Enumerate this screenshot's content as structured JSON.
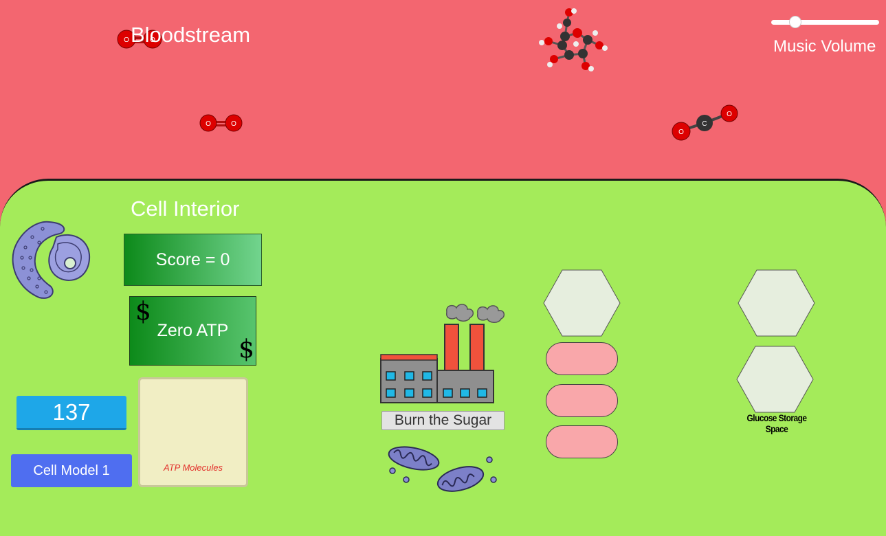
{
  "bloodstream": {
    "title": "Bloodstream"
  },
  "settings": {
    "music_volume_label": "Music Volume",
    "music_volume_level": 0.17
  },
  "cell": {
    "title": "Cell Interior",
    "score_label": "Score = 0",
    "atp_label": "Zero ATP",
    "atp_symbol": "$",
    "counter_value": "137",
    "cell_model_button": "Cell Model 1",
    "atp_panel_label": "ATP Molecules",
    "burn_button": "Burn the Sugar",
    "glucose_storage_label": "Glucose Storage Space"
  },
  "molecules": {
    "oxygen_symbol": "O",
    "carbon_symbol": "C"
  },
  "colors": {
    "bloodstream": "#f36670",
    "cell_interior": "#a4eb5a",
    "score_green": "#0d8a1a",
    "counter_blue": "#1ea7e8",
    "model_button_blue": "#4f6ef0",
    "slot_pink": "#f9a7aa",
    "hexagon_fill": "#e6eede"
  }
}
